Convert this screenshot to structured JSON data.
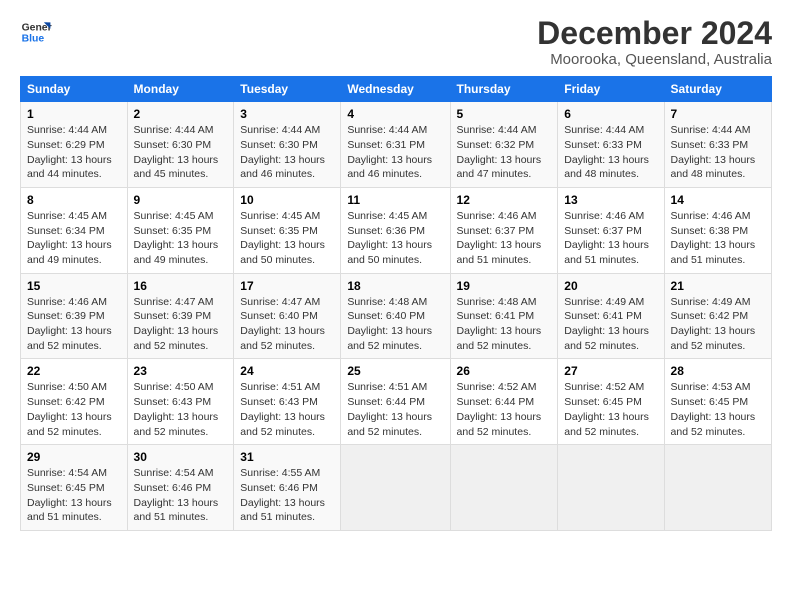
{
  "logo": {
    "line1": "General",
    "line2": "Blue"
  },
  "title": "December 2024",
  "subtitle": "Moorooka, Queensland, Australia",
  "weekdays": [
    "Sunday",
    "Monday",
    "Tuesday",
    "Wednesday",
    "Thursday",
    "Friday",
    "Saturday"
  ],
  "weeks": [
    [
      {
        "day": 1,
        "sunrise": "4:44 AM",
        "sunset": "6:29 PM",
        "daylight": "13 hours and 44 minutes."
      },
      {
        "day": 2,
        "sunrise": "4:44 AM",
        "sunset": "6:30 PM",
        "daylight": "13 hours and 45 minutes."
      },
      {
        "day": 3,
        "sunrise": "4:44 AM",
        "sunset": "6:30 PM",
        "daylight": "13 hours and 46 minutes."
      },
      {
        "day": 4,
        "sunrise": "4:44 AM",
        "sunset": "6:31 PM",
        "daylight": "13 hours and 46 minutes."
      },
      {
        "day": 5,
        "sunrise": "4:44 AM",
        "sunset": "6:32 PM",
        "daylight": "13 hours and 47 minutes."
      },
      {
        "day": 6,
        "sunrise": "4:44 AM",
        "sunset": "6:33 PM",
        "daylight": "13 hours and 48 minutes."
      },
      {
        "day": 7,
        "sunrise": "4:44 AM",
        "sunset": "6:33 PM",
        "daylight": "13 hours and 48 minutes."
      }
    ],
    [
      {
        "day": 8,
        "sunrise": "4:45 AM",
        "sunset": "6:34 PM",
        "daylight": "13 hours and 49 minutes."
      },
      {
        "day": 9,
        "sunrise": "4:45 AM",
        "sunset": "6:35 PM",
        "daylight": "13 hours and 49 minutes."
      },
      {
        "day": 10,
        "sunrise": "4:45 AM",
        "sunset": "6:35 PM",
        "daylight": "13 hours and 50 minutes."
      },
      {
        "day": 11,
        "sunrise": "4:45 AM",
        "sunset": "6:36 PM",
        "daylight": "13 hours and 50 minutes."
      },
      {
        "day": 12,
        "sunrise": "4:46 AM",
        "sunset": "6:37 PM",
        "daylight": "13 hours and 51 minutes."
      },
      {
        "day": 13,
        "sunrise": "4:46 AM",
        "sunset": "6:37 PM",
        "daylight": "13 hours and 51 minutes."
      },
      {
        "day": 14,
        "sunrise": "4:46 AM",
        "sunset": "6:38 PM",
        "daylight": "13 hours and 51 minutes."
      }
    ],
    [
      {
        "day": 15,
        "sunrise": "4:46 AM",
        "sunset": "6:39 PM",
        "daylight": "13 hours and 52 minutes."
      },
      {
        "day": 16,
        "sunrise": "4:47 AM",
        "sunset": "6:39 PM",
        "daylight": "13 hours and 52 minutes."
      },
      {
        "day": 17,
        "sunrise": "4:47 AM",
        "sunset": "6:40 PM",
        "daylight": "13 hours and 52 minutes."
      },
      {
        "day": 18,
        "sunrise": "4:48 AM",
        "sunset": "6:40 PM",
        "daylight": "13 hours and 52 minutes."
      },
      {
        "day": 19,
        "sunrise": "4:48 AM",
        "sunset": "6:41 PM",
        "daylight": "13 hours and 52 minutes."
      },
      {
        "day": 20,
        "sunrise": "4:49 AM",
        "sunset": "6:41 PM",
        "daylight": "13 hours and 52 minutes."
      },
      {
        "day": 21,
        "sunrise": "4:49 AM",
        "sunset": "6:42 PM",
        "daylight": "13 hours and 52 minutes."
      }
    ],
    [
      {
        "day": 22,
        "sunrise": "4:50 AM",
        "sunset": "6:42 PM",
        "daylight": "13 hours and 52 minutes."
      },
      {
        "day": 23,
        "sunrise": "4:50 AM",
        "sunset": "6:43 PM",
        "daylight": "13 hours and 52 minutes."
      },
      {
        "day": 24,
        "sunrise": "4:51 AM",
        "sunset": "6:43 PM",
        "daylight": "13 hours and 52 minutes."
      },
      {
        "day": 25,
        "sunrise": "4:51 AM",
        "sunset": "6:44 PM",
        "daylight": "13 hours and 52 minutes."
      },
      {
        "day": 26,
        "sunrise": "4:52 AM",
        "sunset": "6:44 PM",
        "daylight": "13 hours and 52 minutes."
      },
      {
        "day": 27,
        "sunrise": "4:52 AM",
        "sunset": "6:45 PM",
        "daylight": "13 hours and 52 minutes."
      },
      {
        "day": 28,
        "sunrise": "4:53 AM",
        "sunset": "6:45 PM",
        "daylight": "13 hours and 52 minutes."
      }
    ],
    [
      {
        "day": 29,
        "sunrise": "4:54 AM",
        "sunset": "6:45 PM",
        "daylight": "13 hours and 51 minutes."
      },
      {
        "day": 30,
        "sunrise": "4:54 AM",
        "sunset": "6:46 PM",
        "daylight": "13 hours and 51 minutes."
      },
      {
        "day": 31,
        "sunrise": "4:55 AM",
        "sunset": "6:46 PM",
        "daylight": "13 hours and 51 minutes."
      },
      null,
      null,
      null,
      null
    ]
  ]
}
